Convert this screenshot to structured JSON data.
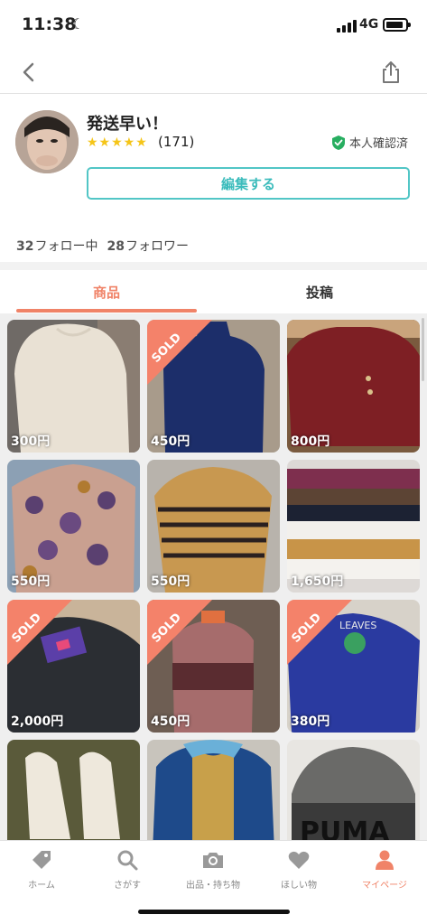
{
  "status_bar": {
    "time": "11:38",
    "network": "4G"
  },
  "navbar": {
    "back_icon": "chevron-left-icon",
    "share_icon": "share-icon"
  },
  "profile": {
    "name": "発送早い！",
    "stars": "★★★★★",
    "rating_count": "(171)",
    "verified_label": "本人確認済",
    "edit_button": "編集する",
    "following_count": "32",
    "following_label": "フォロー中",
    "followers_count": "28",
    "followers_label": "フォロワー"
  },
  "tabs": {
    "items": "商品",
    "posts": "投稿"
  },
  "items": [
    {
      "price": "300円",
      "sold": false
    },
    {
      "price": "450円",
      "sold": true
    },
    {
      "price": "800円",
      "sold": false
    },
    {
      "price": "550円",
      "sold": false
    },
    {
      "price": "550円",
      "sold": false
    },
    {
      "price": "1,650円",
      "sold": false
    },
    {
      "price": "2,000円",
      "sold": true
    },
    {
      "price": "450円",
      "sold": true
    },
    {
      "price": "380円",
      "sold": true
    },
    {
      "price": "",
      "sold": false
    },
    {
      "price": "",
      "sold": false
    },
    {
      "price": "",
      "sold": false
    }
  ],
  "sold_label": "SOLD",
  "image_text": {
    "sweater_logo": "LEAVES",
    "hat_logo": "PUMA"
  },
  "tabbar": [
    {
      "label": "ホーム",
      "icon": "tag-icon"
    },
    {
      "label": "さがす",
      "icon": "search-icon"
    },
    {
      "label": "出品・持ち物",
      "icon": "camera-icon"
    },
    {
      "label": "ほしい物",
      "icon": "heart-icon"
    },
    {
      "label": "マイページ",
      "icon": "person-icon"
    }
  ],
  "colors": {
    "accent": "#f08368",
    "teal": "#52c6c6",
    "star": "#f5c518",
    "verified": "#27ae60"
  }
}
